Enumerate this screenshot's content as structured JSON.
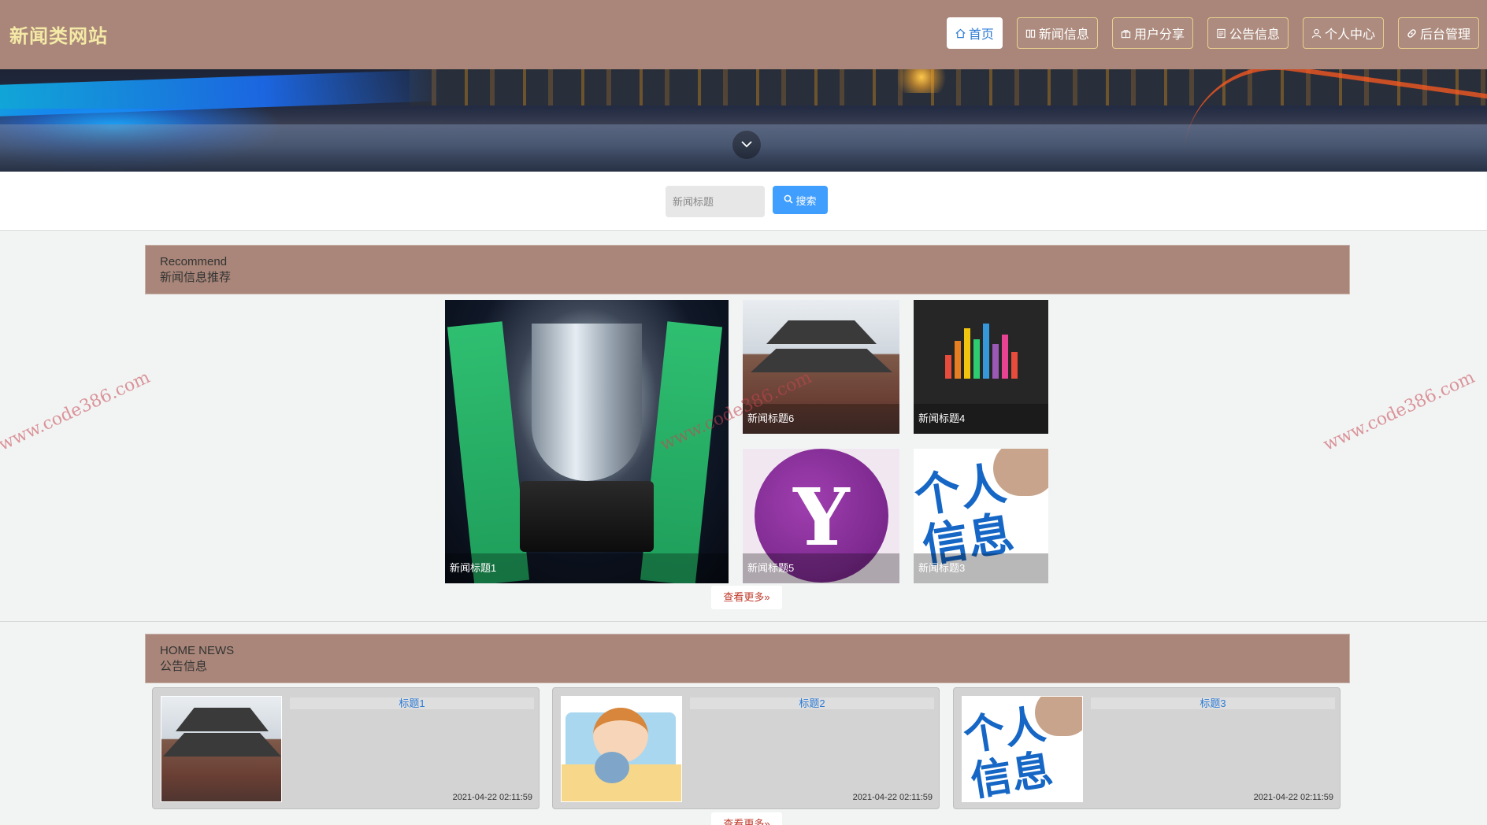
{
  "header": {
    "brand": "新闻类网站",
    "nav": [
      {
        "label": "首页",
        "icon": "home-icon"
      },
      {
        "label": "新闻信息",
        "icon": "book-icon"
      },
      {
        "label": "用户分享",
        "icon": "share-icon"
      },
      {
        "label": "公告信息",
        "icon": "notice-icon"
      },
      {
        "label": "个人中心",
        "icon": "user-icon"
      },
      {
        "label": "后台管理",
        "icon": "link-icon"
      }
    ]
  },
  "search": {
    "placeholder": "新闻标题",
    "button_label": "搜索"
  },
  "recommend": {
    "title_en": "Recommend",
    "title_cn": "新闻信息推荐",
    "items": [
      {
        "caption": "新闻标题1"
      },
      {
        "caption": "新闻标题6"
      },
      {
        "caption": "新闻标题4"
      },
      {
        "caption": "新闻标题5"
      },
      {
        "caption": "新闻标题3"
      }
    ],
    "more_label": "查看更多»"
  },
  "news": {
    "title_en": "HOME NEWS",
    "title_cn": "公告信息",
    "items": [
      {
        "title": "标题1",
        "date": "2021-04-22 02:11:59"
      },
      {
        "title": "标题2",
        "date": "2021-04-22 02:11:59"
      },
      {
        "title": "标题3",
        "date": "2021-04-22 02:11:59"
      }
    ],
    "more_label": "查看更多»"
  },
  "watermark": "www.code386.com",
  "colors": {
    "header_bg": "#a98679",
    "brand_text": "#f4e9a6",
    "search_button": "#409eff",
    "link_blue": "#2d7bd4",
    "more_red": "#c0392b"
  }
}
